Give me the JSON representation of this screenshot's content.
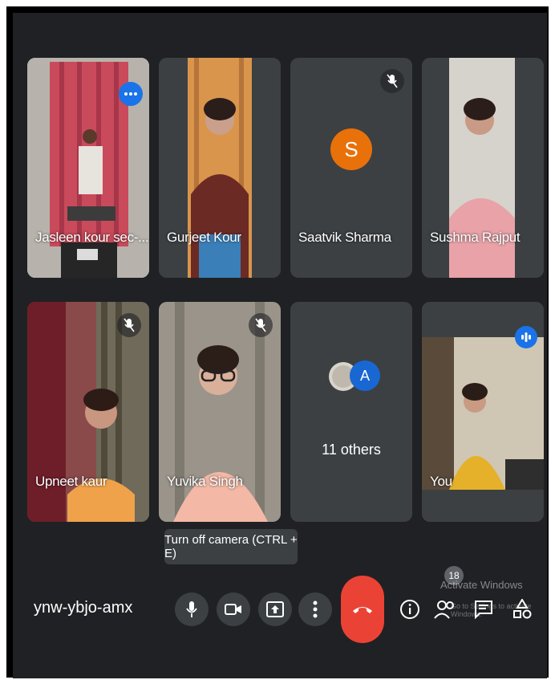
{
  "participants": [
    {
      "name": "Jasleen kour sec-..."
    },
    {
      "name": "Gurjeet Kour"
    },
    {
      "name": "Saatvik Sharma",
      "avatar_letter": "S"
    },
    {
      "name": "Sushma Rajput"
    },
    {
      "name": "Upneet kaur"
    },
    {
      "name": "Yuvika Singh"
    },
    {
      "others_label": "11 others",
      "avatar_letter": "A"
    },
    {
      "name": "You"
    }
  ],
  "tooltip": {
    "text": "Turn off camera (CTRL + E)"
  },
  "meeting": {
    "code": "ynw-ybjo-amx"
  },
  "people_count": "18",
  "watermark": {
    "line1": "Activate Windows",
    "line2": "Go to Settings to activate Windows."
  },
  "colors": {
    "background": "#202124",
    "tile": "#3c4043",
    "accent": "#1a73e8",
    "hangup": "#ea4335",
    "avatar": "#e8710a"
  },
  "icons": [
    "more-options-icon",
    "mic-off-icon",
    "audio-indicator-icon",
    "microphone-icon",
    "camera-icon",
    "present-screen-icon",
    "more-vert-icon",
    "call-end-icon",
    "info-icon",
    "people-icon",
    "chat-icon",
    "activities-icon"
  ]
}
